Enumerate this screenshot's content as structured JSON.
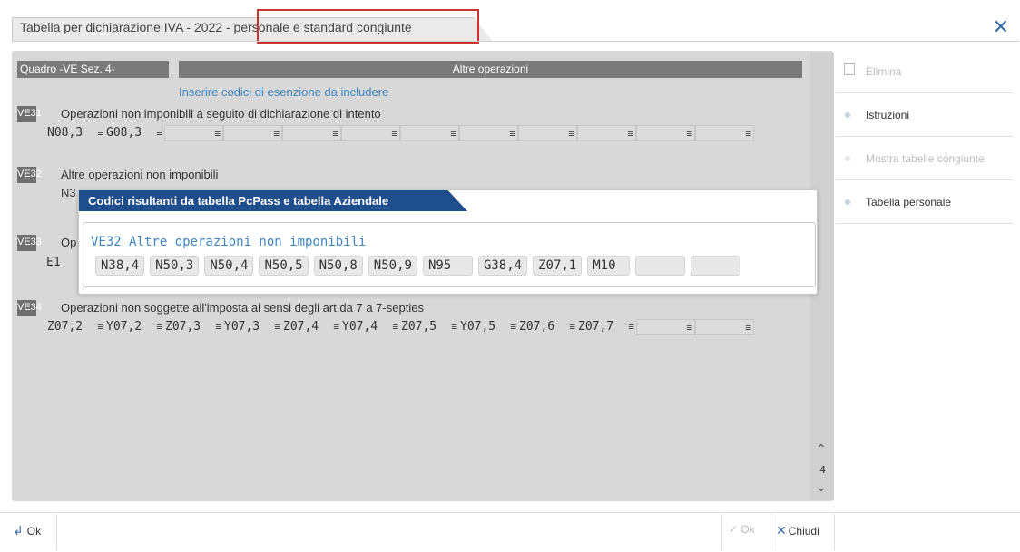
{
  "window": {
    "title_prefix": "Tabella per dichiarazione IVA - 2022 - ",
    "title_highlight": "personale e standard congiunte",
    "close_icon": "✕"
  },
  "header": {
    "quadro": "Quadro -VE Sez. 4-",
    "section": "Altre operazioni",
    "hint": "Inserire codici di esenzione da includere"
  },
  "rows": [
    {
      "code": "VE31",
      "label": "Operazioni non imponibili a seguito di dichiarazione di intento",
      "fields": [
        "N08,3",
        "G08,3",
        "",
        "",
        "",
        "",
        "",
        "",
        "",
        "",
        "",
        "",
        ""
      ]
    },
    {
      "code": "VE32",
      "label": "Altre operazioni non imponibili",
      "visible_fragment": "N3"
    },
    {
      "code": "VE33",
      "label_fragment": "Op",
      "visible_fragment": "E1"
    },
    {
      "code": "VE34",
      "label": "Operazioni non soggette all'imposta ai sensi degli art.da 7 a 7-septies",
      "fields": [
        "Z07,2",
        "Y07,2",
        "Z07,3",
        "Y07,3",
        "Z07,4",
        "Y07,4",
        "Z07,5",
        "Y07,5",
        "Z07,6",
        "Z07,7",
        "",
        "",
        ""
      ]
    }
  ],
  "popup": {
    "header": "Codici risultanti da tabella PcPass e tabella Aziendale",
    "title": "VE32 Altre operazioni non imponibili",
    "codes": [
      "N38,4",
      "N50,3",
      "N50,4",
      "N50,5",
      "N50,8",
      "N50,9",
      "N95",
      "G38,4",
      "Z07,1",
      "M10",
      "",
      ""
    ]
  },
  "scroll": {
    "page": "4",
    "up_icon": "⌃",
    "down_icon": "⌄"
  },
  "side_menu": {
    "items": [
      {
        "label": "Elimina",
        "enabled": false
      },
      {
        "label": "Istruzioni",
        "enabled": true
      },
      {
        "label": "Mostra tabelle congiunte",
        "enabled": false
      },
      {
        "label": "Tabella personale",
        "enabled": true
      }
    ]
  },
  "footer": {
    "ok_left": "Ok",
    "ok_right": "Ok",
    "close": "Chiudi"
  }
}
